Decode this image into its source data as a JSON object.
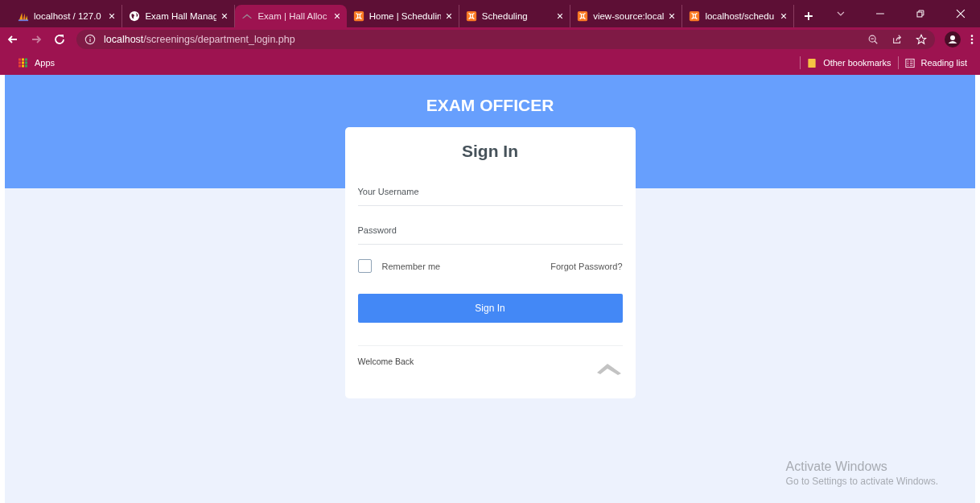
{
  "tabs": [
    {
      "title": "localhost / 127.0",
      "kind": "sails",
      "selected": false
    },
    {
      "title": "Exam Hall Manag",
      "kind": "globe",
      "selected": false
    },
    {
      "title": "Exam | Hall Alloc",
      "kind": "roof",
      "selected": true
    },
    {
      "title": "Home | Schedulin",
      "kind": "xampp",
      "selected": false
    },
    {
      "title": "Scheduling",
      "kind": "xampp",
      "selected": false
    },
    {
      "title": "view-source:local",
      "kind": "xampp",
      "selected": false
    },
    {
      "title": "localhost/schedu",
      "kind": "xampp",
      "selected": false
    }
  ],
  "address_bar": {
    "host": "localhost",
    "path": "/screenings/department_login.php"
  },
  "bookmarks_bar": {
    "apps": "Apps",
    "other": "Other bookmarks",
    "reading": "Reading list"
  },
  "page": {
    "header": "EXAM OFFICER",
    "card": {
      "title": "Sign In",
      "username": {
        "placeholder": "Your Username"
      },
      "password": {
        "placeholder": "Password"
      },
      "remember": {
        "label": "Remember me",
        "checked": false
      },
      "forgot": "Forgot Password?",
      "button": "Sign In",
      "footer": "Welcome Back"
    }
  },
  "os_notice": {
    "title": "Activate Windows",
    "text": "Go to Settings to activate Windows."
  }
}
